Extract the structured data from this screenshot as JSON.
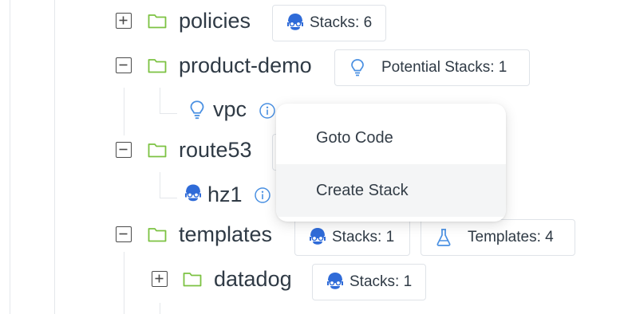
{
  "tree": {
    "policies": {
      "name": "policies",
      "badge": "Stacks: 6"
    },
    "product_demo": {
      "name": "product-demo",
      "badge": "Potential Stacks: 1",
      "child": {
        "name": "vpc"
      }
    },
    "route53": {
      "name": "route53",
      "child": {
        "name": "hz1"
      }
    },
    "templates": {
      "name": "templates",
      "stacks_badge": "Stacks: 1",
      "templates_badge": "Templates: 4",
      "child": {
        "name": "datadog",
        "badge": "Stacks: 1"
      }
    }
  },
  "context_menu": {
    "items": [
      {
        "label": "Goto Code"
      },
      {
        "label": "Create Stack"
      }
    ]
  },
  "colors": {
    "folder": "#7cc242",
    "bulb": "#4a90e2",
    "stack_icon": "#2f6bd8",
    "info": "#4a90e2",
    "text": "#2f3a45"
  }
}
